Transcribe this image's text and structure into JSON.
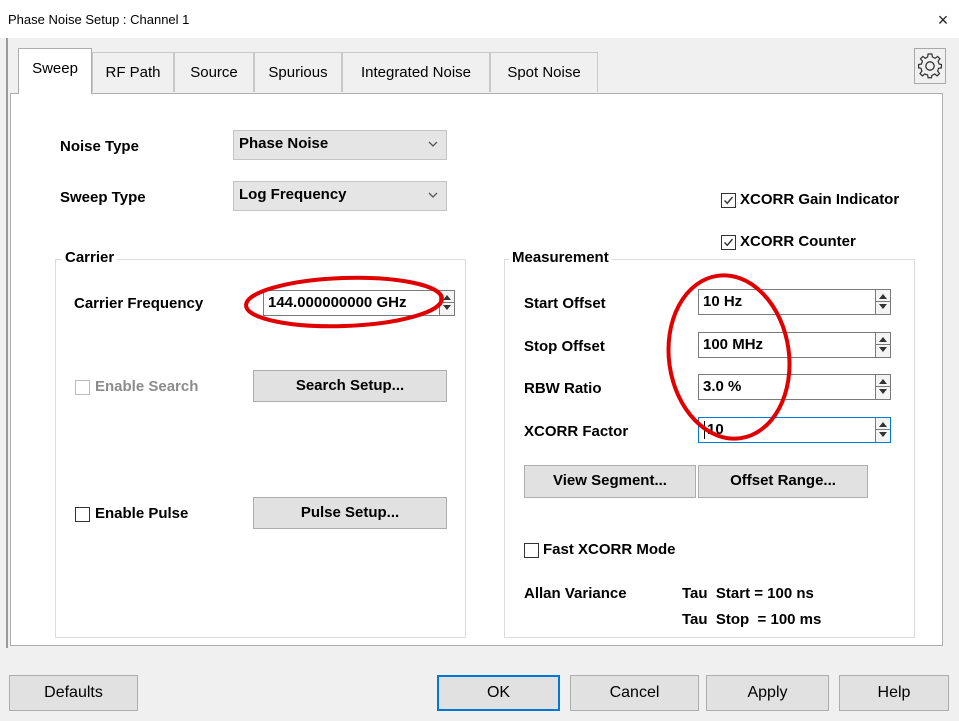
{
  "window": {
    "title": "Phase Noise Setup : Channel 1",
    "close_glyph": "×"
  },
  "tabs": [
    {
      "label": "Sweep",
      "active": true
    },
    {
      "label": "RF Path"
    },
    {
      "label": "Source"
    },
    {
      "label": "Spurious"
    },
    {
      "label": "Integrated Noise"
    },
    {
      "label": "Spot Noise"
    }
  ],
  "sweep": {
    "noise_type_label": "Noise Type",
    "noise_type_value": "Phase Noise",
    "sweep_type_label": "Sweep Type",
    "sweep_type_value": "Log Frequency",
    "xcorr_gain_indicator": {
      "label": "XCORR Gain Indicator",
      "checked": true
    },
    "xcorr_counter": {
      "label": "XCORR Counter",
      "checked": true
    }
  },
  "carrier": {
    "group_title": "Carrier",
    "frequency_label": "Carrier Frequency",
    "frequency_value": "144.000000000 GHz",
    "enable_search": {
      "label": "Enable Search",
      "checked": false,
      "enabled": false
    },
    "search_setup_label": "Search Setup...",
    "enable_pulse": {
      "label": "Enable Pulse",
      "checked": false
    },
    "pulse_setup_label": "Pulse Setup..."
  },
  "measurement": {
    "group_title": "Measurement",
    "start_offset_label": "Start Offset",
    "start_offset_value": "10 Hz",
    "stop_offset_label": "Stop Offset",
    "stop_offset_value": "100 MHz",
    "rbw_ratio_label": "RBW Ratio",
    "rbw_ratio_value": "3.0 %",
    "xcorr_factor_label": "XCORR Factor",
    "xcorr_factor_value": "10",
    "view_segment_label": "View Segment...",
    "offset_range_label": "Offset Range...",
    "fast_xcorr": {
      "label": "Fast XCORR Mode",
      "checked": false
    },
    "allan_variance_label": "Allan Variance",
    "tau_start": "Tau  Start = 100 ns",
    "tau_stop": "Tau  Stop  = 100 ms"
  },
  "buttons": {
    "defaults": "Defaults",
    "ok": "OK",
    "cancel": "Cancel",
    "apply": "Apply",
    "help": "Help"
  },
  "colors": {
    "focus_blue": "#0078d7",
    "annotation_red": "#e00000",
    "panel_bg": "#ffffff",
    "dialog_bg": "#f0f0f0"
  },
  "icons": {
    "gear": "gear-icon",
    "close": "close-icon",
    "dropdown": "chevron-down-icon",
    "checkmark": "check-icon"
  }
}
